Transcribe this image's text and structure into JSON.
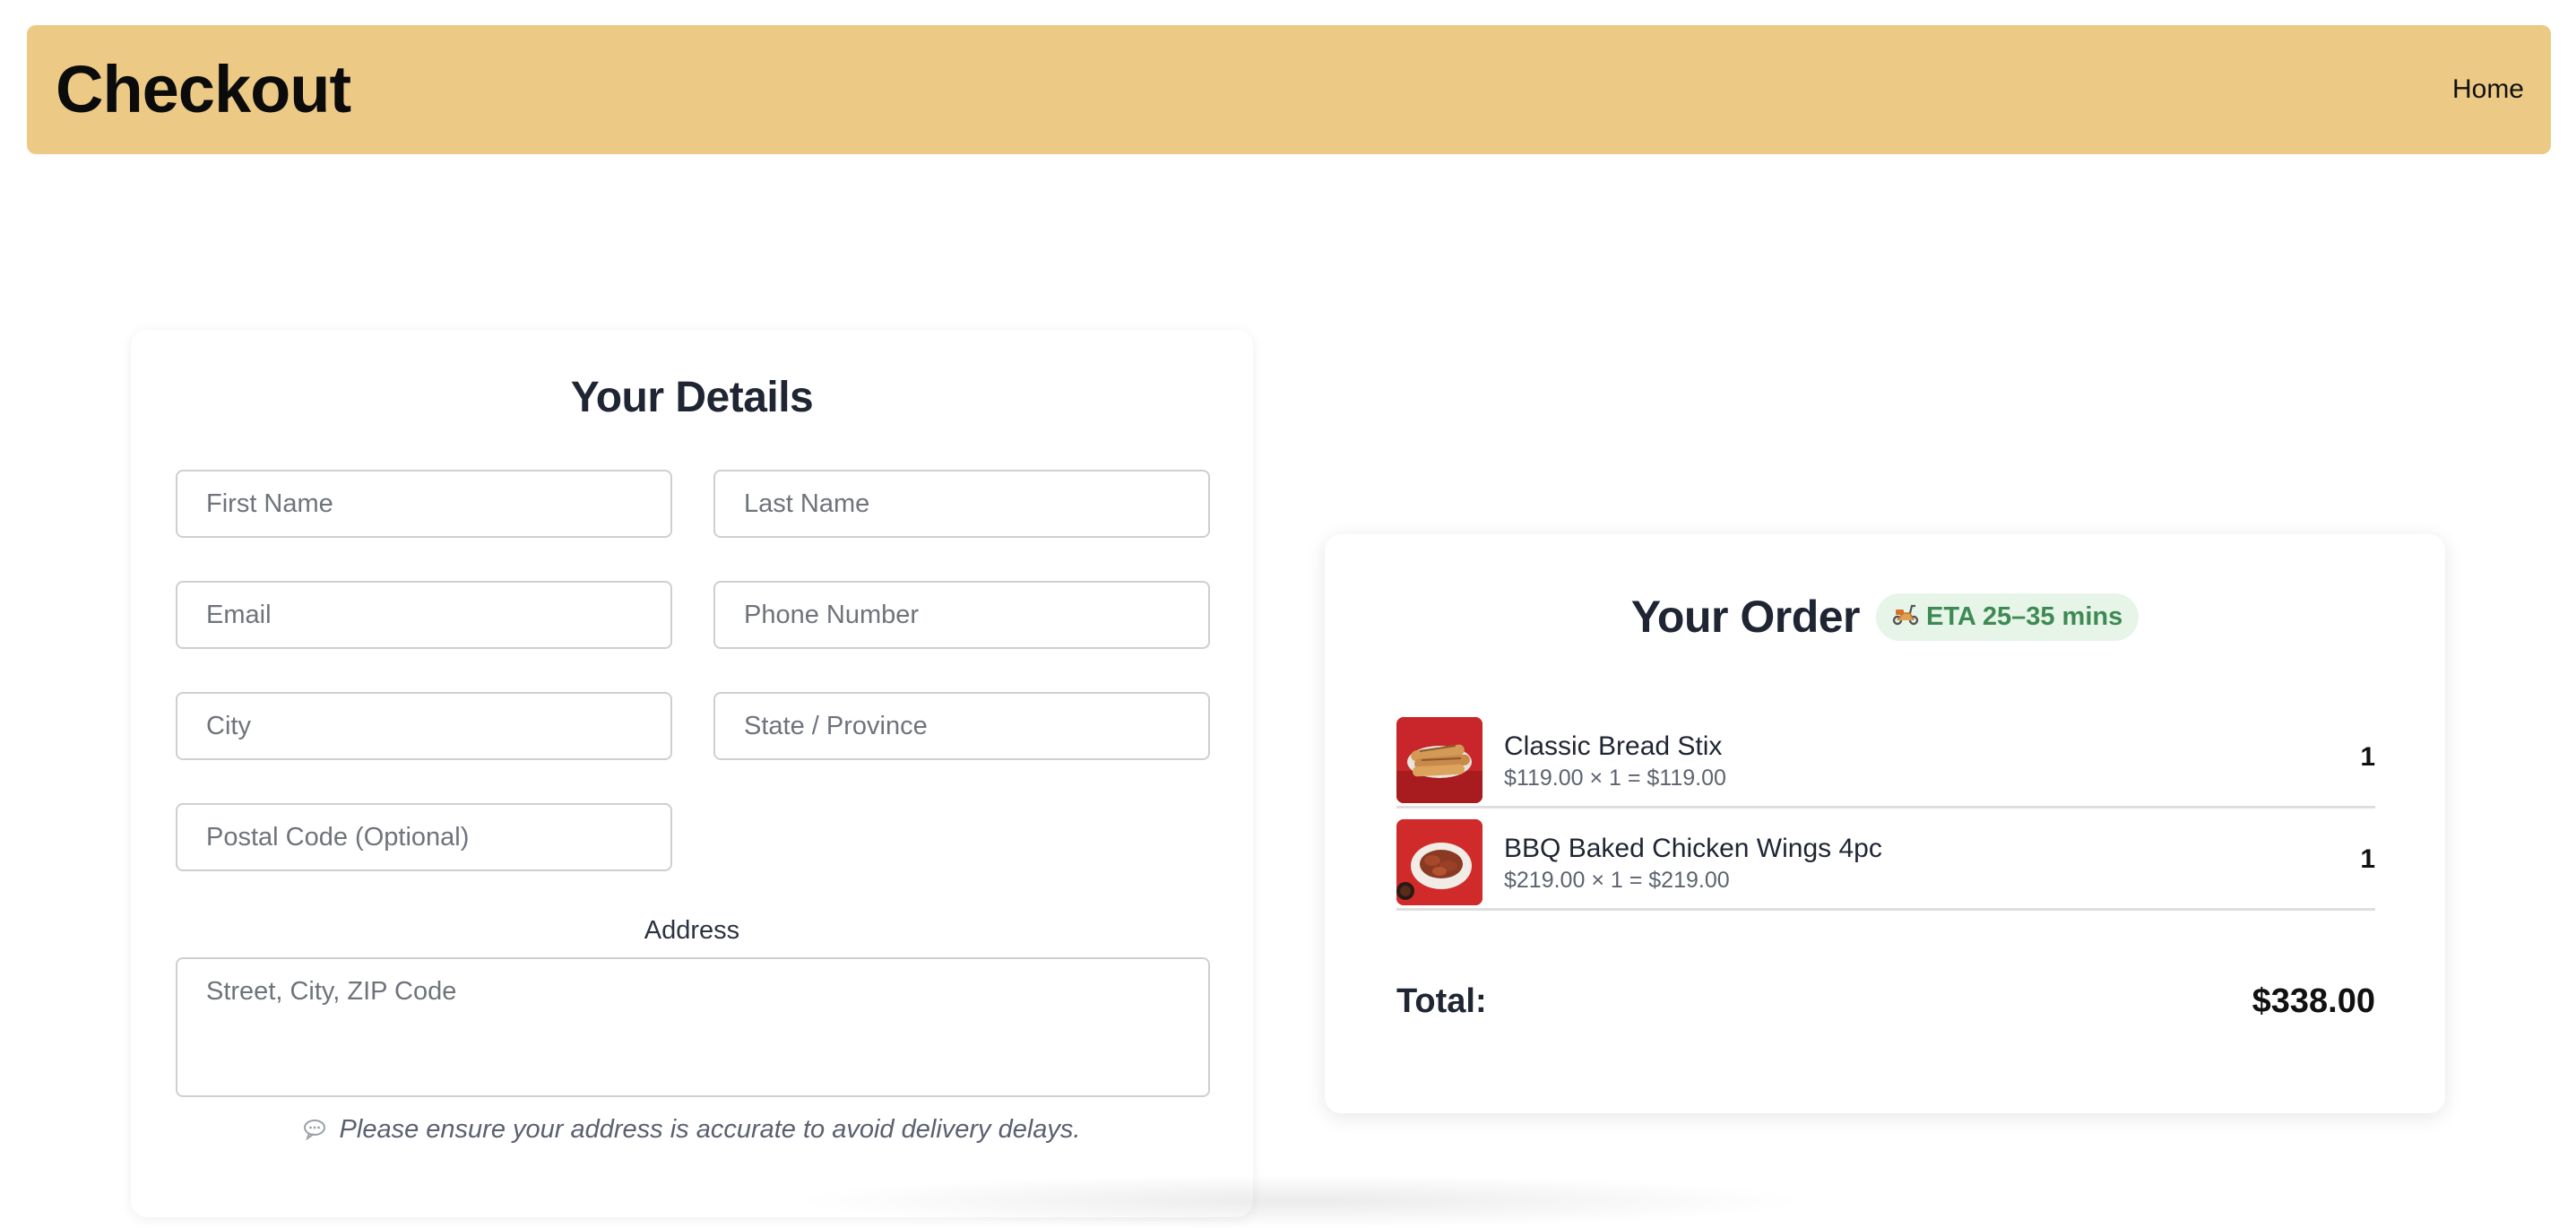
{
  "header": {
    "title": "Checkout",
    "home_link": "Home",
    "background": "#ecca86"
  },
  "details": {
    "title": "Your Details",
    "fields": {
      "first_name": {
        "placeholder": "First Name",
        "value": ""
      },
      "last_name": {
        "placeholder": "Last Name",
        "value": ""
      },
      "email": {
        "placeholder": "Email",
        "value": ""
      },
      "phone": {
        "placeholder": "Phone Number",
        "value": ""
      },
      "city": {
        "placeholder": "City",
        "value": ""
      },
      "state": {
        "placeholder": "State / Province",
        "value": ""
      },
      "postal": {
        "placeholder": "Postal Code (Optional)",
        "value": ""
      }
    },
    "address_label": "Address",
    "address_placeholder": "Street, City, ZIP Code",
    "hint_icon": "speech-bubble-icon",
    "hint": "Please ensure your address is accurate to avoid delivery delays."
  },
  "order": {
    "title": "Your Order",
    "eta_icon": "scooter-icon",
    "eta": "ETA 25–35 mins",
    "items": [
      {
        "name": "Classic Bread Stix",
        "price_line": "$119.00 × 1 = $119.00",
        "qty": "1",
        "image": "bread-stix-thumbnail"
      },
      {
        "name": "BBQ Baked Chicken Wings 4pc",
        "price_line": "$219.00 × 1 = $219.00",
        "qty": "1",
        "image": "chicken-wings-thumbnail"
      }
    ],
    "total_label": "Total:",
    "total_value": "$338.00"
  }
}
